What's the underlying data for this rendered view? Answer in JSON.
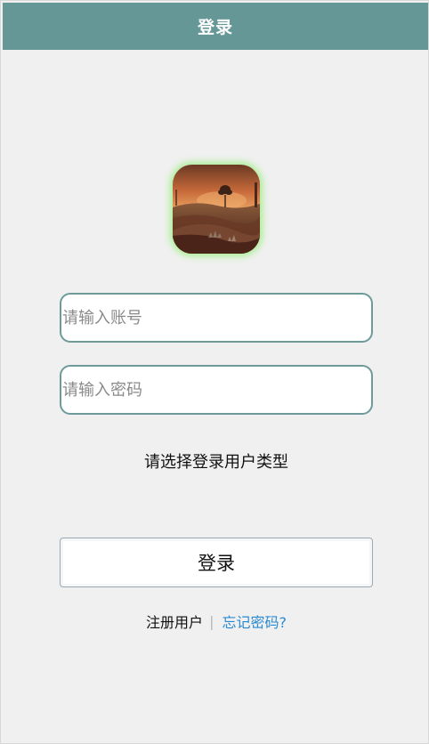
{
  "header": {
    "title": "登录"
  },
  "form": {
    "account_placeholder": "请输入账号",
    "password_placeholder": "请输入密码",
    "user_type_prompt": "请选择登录用户类型",
    "login_label": "登录"
  },
  "links": {
    "register": "注册用户",
    "separator": "|",
    "forgot": "忘记密码?"
  },
  "colors": {
    "header_bg": "#669797",
    "field_border": "#6e9a9a",
    "avatar_glow": "#a9ee92",
    "link": "#2a8ad0"
  },
  "avatar": {
    "icon": "landscape-sunset-image"
  }
}
